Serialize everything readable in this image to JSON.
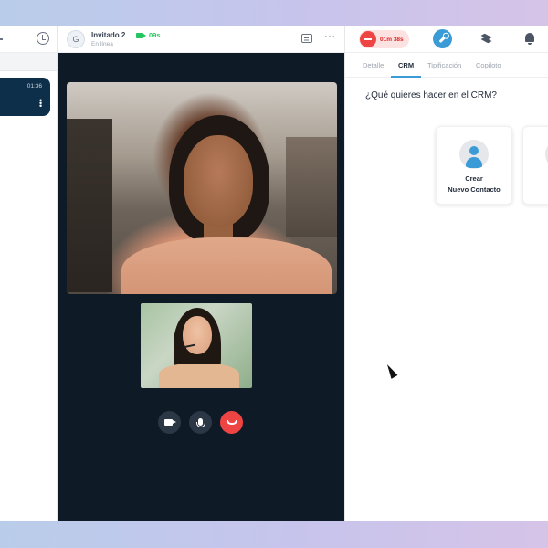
{
  "left_panel": {
    "conversation": {
      "time": "01:36"
    }
  },
  "call_header": {
    "avatar_initial": "G",
    "guest_name": "Invitado 2",
    "guest_status": "En línea",
    "video_timer": "09s"
  },
  "right_panel": {
    "timer": "01m 38s",
    "tabs": [
      {
        "label": "Detalle",
        "active": false
      },
      {
        "label": "CRM",
        "active": true
      },
      {
        "label": "Tipificación",
        "active": false
      },
      {
        "label": "Copiloto",
        "active": false
      }
    ],
    "question": "¿Qué quieres hacer en el CRM?",
    "cards": [
      {
        "line1": "Crear",
        "line2": "Nuevo Contacto"
      }
    ]
  },
  "colors": {
    "accent": "#3a9bd6",
    "danger": "#ef4444",
    "online": "#22c55e",
    "dark_card": "#0e2f4a",
    "stage_bg": "#0e1a25"
  }
}
